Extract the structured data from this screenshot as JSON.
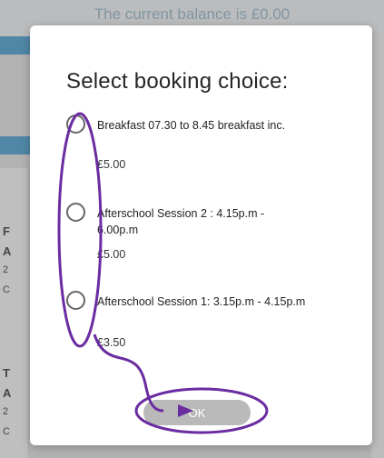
{
  "background": {
    "balance_text": "The current balance is £0.00",
    "list_letters": [
      "F",
      "A",
      "2",
      "C",
      "T",
      "A",
      "2",
      "C"
    ]
  },
  "dialog": {
    "title": "Select booking choice:",
    "options": [
      {
        "label": "Breakfast 07.30 to 8.45 breakfast inc.",
        "price": "£5.00",
        "selected": false
      },
      {
        "label": "Afterschool Session 2 : 4.15p.m - 6.00p.m",
        "price": "£5.00",
        "selected": false
      },
      {
        "label": "Afterschool Session 1: 3.15p.m - 4.15p.m",
        "price": "£3.50",
        "selected": false
      }
    ],
    "ok_label": "OK"
  },
  "annotation": {
    "color": "#6a2ca0",
    "arrow_icon": "arrow-right-icon"
  }
}
